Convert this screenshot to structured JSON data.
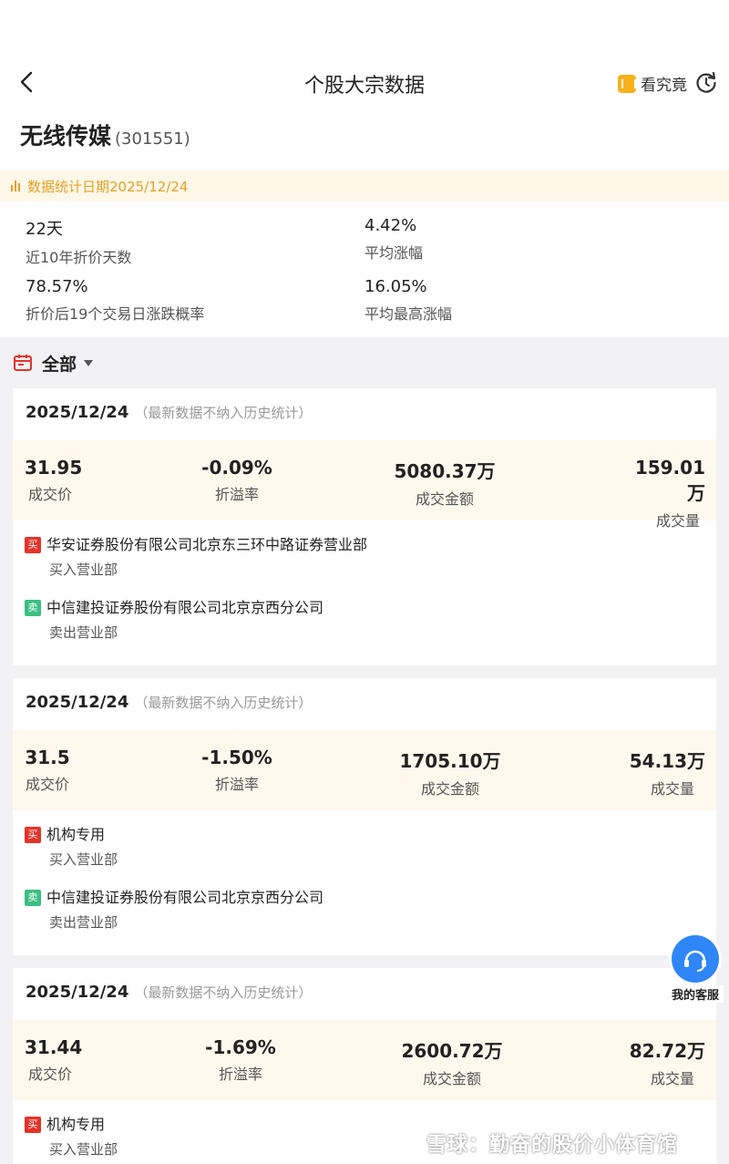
{
  "header": {
    "title": "个股大宗数据",
    "kanjiujing_label": "看究竟"
  },
  "stock": {
    "name": "无线传媒",
    "code": "(301551)"
  },
  "stats_date": "数据统计日期2025/12/24",
  "summary": [
    {
      "value": "22天",
      "label": "近10年折价天数"
    },
    {
      "value": "4.42%",
      "label": "平均涨幅"
    },
    {
      "value": "78.57%",
      "label": "折价后19个交易日涨跌概率"
    },
    {
      "value": "16.05%",
      "label": "平均最高涨幅"
    }
  ],
  "filter": {
    "label": "全部"
  },
  "metric_labels": {
    "price": "成交价",
    "premium": "折溢率",
    "amount": "成交金额",
    "volume": "成交量"
  },
  "tags": {
    "buy": "买",
    "sell": "卖"
  },
  "roles": {
    "buy": "买入营业部",
    "sell": "卖出营业部"
  },
  "records": [
    {
      "date": "2025/12/24",
      "note": "（最新数据不纳入历史统计）",
      "price": "31.95",
      "premium": "-0.09%",
      "amount": "5080.37万",
      "volume": "159.01万",
      "buyer": "华安证券股份有限公司北京东三环中路证券营业部",
      "seller": "中信建投证券股份有限公司北京京西分公司"
    },
    {
      "date": "2025/12/24",
      "note": "（最新数据不纳入历史统计）",
      "price": "31.5",
      "premium": "-1.50%",
      "amount": "1705.10万",
      "volume": "54.13万",
      "buyer": "机构专用",
      "seller": "中信建投证券股份有限公司北京京西分公司"
    },
    {
      "date": "2025/12/24",
      "note": "（最新数据不纳入历史统计）",
      "price": "31.44",
      "premium": "-1.69%",
      "amount": "2600.72万",
      "volume": "82.72万",
      "buyer": "机构专用",
      "seller": ""
    }
  ],
  "customer_service": "我的客服",
  "watermark": "雪球：勤奋的股价小体育馆",
  "colors": {
    "accent": "#e5a026",
    "buy": "#e6332a",
    "sell": "#3bbf82",
    "service": "#2f86f6"
  }
}
